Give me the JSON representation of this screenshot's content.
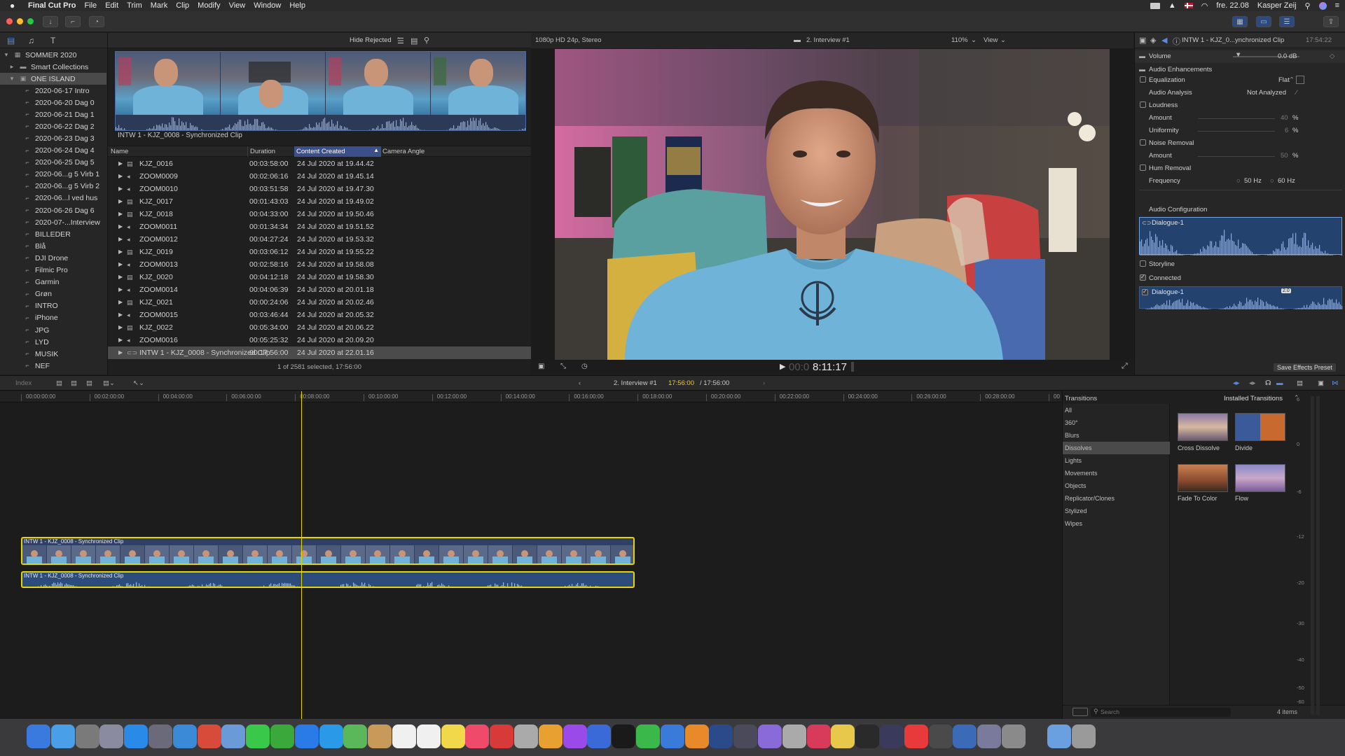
{
  "menubar": {
    "app": "Final Cut Pro",
    "items": [
      "File",
      "Edit",
      "Trim",
      "Mark",
      "Clip",
      "Modify",
      "View",
      "Window",
      "Help"
    ],
    "clock": "fre. 22.08",
    "user": "Kasper Zeij"
  },
  "libraries": {
    "root": "SOMMER 2020",
    "smart": "Smart Collections",
    "island": "ONE ISLAND",
    "items": [
      "2020-06-17 Intro",
      "2020-06-20 Dag 0",
      "2020-06-21 Dag 1",
      "2020-06-22 Dag 2",
      "2020-06-23 Dag 3",
      "2020-06-24 Dag 4",
      "2020-06-25 Dag 5",
      "2020-06...g 5 Virb 1",
      "2020-06...g 5 Virb 2",
      "2020-06...l ved hus",
      "2020-06-26 Dag 6",
      "2020-07-...Interview",
      "BILLEDER",
      "Blå",
      "DJI Drone",
      "Filmic Pro",
      "Garmin",
      "Grøn",
      "INTRO",
      "iPhone",
      "JPG",
      "LYD",
      "MUSIK",
      "NEF"
    ]
  },
  "browser": {
    "hide_rejected": "Hide Rejected",
    "clip_title": "INTW 1 - KJZ_0008 - Synchronized Clip",
    "columns": {
      "name": "Name",
      "duration": "Duration",
      "content_created": "Content Created",
      "camera_angle": "Camera Angle"
    },
    "rows": [
      {
        "name": "KJZ_0016",
        "duration": "00:03:58:00",
        "created": "24 Jul 2020 at 19.44.42",
        "type": "video"
      },
      {
        "name": "ZOOM0009",
        "duration": "00:02:06:16",
        "created": "24 Jul 2020 at 19.45.14",
        "type": "audio"
      },
      {
        "name": "ZOOM0010",
        "duration": "00:03:51:58",
        "created": "24 Jul 2020 at 19.47.30",
        "type": "audio"
      },
      {
        "name": "KJZ_0017",
        "duration": "00:01:43:03",
        "created": "24 Jul 2020 at 19.49.02",
        "type": "video"
      },
      {
        "name": "KJZ_0018",
        "duration": "00:04:33:00",
        "created": "24 Jul 2020 at 19.50.46",
        "type": "video"
      },
      {
        "name": "ZOOM0011",
        "duration": "00:01:34:34",
        "created": "24 Jul 2020 at 19.51.52",
        "type": "audio"
      },
      {
        "name": "ZOOM0012",
        "duration": "00:04:27:24",
        "created": "24 Jul 2020 at 19.53.32",
        "type": "audio"
      },
      {
        "name": "KJZ_0019",
        "duration": "00:03:06:12",
        "created": "24 Jul 2020 at 19.55.22",
        "type": "video"
      },
      {
        "name": "ZOOM0013",
        "duration": "00:02:58:16",
        "created": "24 Jul 2020 at 19.58.08",
        "type": "audio"
      },
      {
        "name": "KJZ_0020",
        "duration": "00:04:12:18",
        "created": "24 Jul 2020 at 19.58.30",
        "type": "video"
      },
      {
        "name": "ZOOM0014",
        "duration": "00:04:06:39",
        "created": "24 Jul 2020 at 20.01.18",
        "type": "audio"
      },
      {
        "name": "KJZ_0021",
        "duration": "00:00:24:06",
        "created": "24 Jul 2020 at 20.02.46",
        "type": "video"
      },
      {
        "name": "ZOOM0015",
        "duration": "00:03:46:44",
        "created": "24 Jul 2020 at 20.05.32",
        "type": "audio"
      },
      {
        "name": "KJZ_0022",
        "duration": "00:05:34:00",
        "created": "24 Jul 2020 at 20.06.22",
        "type": "video"
      },
      {
        "name": "ZOOM0016",
        "duration": "00:05:25:32",
        "created": "24 Jul 2020 at 20.09.20",
        "type": "audio"
      },
      {
        "name": "INTW 1 - KJZ_0008 - Synchronized Clip",
        "duration": "00:17:56:00",
        "created": "24 Jul 2020 at 22.01.16",
        "type": "sync"
      }
    ],
    "status": "1 of 2581 selected, 17:56:00"
  },
  "viewer": {
    "format": "1080p HD 24p, Stereo",
    "title": "2. Interview #1",
    "zoom": "110%",
    "view": "View",
    "timecode_dim": "00:0",
    "timecode": "8:11:17"
  },
  "inspector": {
    "header": "INTW 1 - KJZ_0...ynchronized Clip",
    "header_time": "17:54:22",
    "volume_label": "Volume",
    "volume_value": "0.0 dB",
    "audio_enh": "Audio Enhancements",
    "eq_label": "Equalization",
    "eq_value": "Flat",
    "analysis_label": "Audio Analysis",
    "analysis_value": "Not Analyzed",
    "loudness": "Loudness",
    "amount": "Amount",
    "amount_value": "40",
    "pct": "%",
    "uniformity": "Uniformity",
    "uniformity_value": "6",
    "noise": "Noise Removal",
    "noise_amount_value": "50",
    "hum": "Hum Removal",
    "frequency": "Frequency",
    "freq50": "50 Hz",
    "freq60": "60 Hz",
    "audio_config": "Audio Configuration",
    "dialogue": "Dialogue-1",
    "storyline": "Storyline",
    "connected": "Connected",
    "dialogue2": "Dialogue-1",
    "channel_badge": "2.0",
    "save_preset": "Save Effects Preset"
  },
  "timeline_bar": {
    "index": "Index",
    "project": "2. Interview #1",
    "time": "17:56:00",
    "total": "/ 17:56:00"
  },
  "ruler": [
    "00:00:00:00",
    "00:02:00:00",
    "00:04:00:00",
    "00:06:00:00",
    "00:08:00:00",
    "00:10:00:00",
    "00:12:00:00",
    "00:14:00:00",
    "00:16:00:00",
    "00:18:00:00",
    "00:20:00:00",
    "00:22:00:00",
    "00:24:00:00",
    "00:26:00:00",
    "00:28:00:00",
    "00"
  ],
  "clips": {
    "video_label": "INTW 1 - KJZ_0008 - Synchronized Clip",
    "audio_label": "INTW 1 - KJZ_0008 - Synchronized Clip"
  },
  "transitions": {
    "header": "Transitions",
    "installed": "Installed Transitions",
    "categories": [
      "All",
      "360°",
      "Blurs",
      "Dissolves",
      "Lights",
      "Movements",
      "Objects",
      "Replicator/Clones",
      "Stylized",
      "Wipes"
    ],
    "selected_category": "Dissolves",
    "items": [
      "Cross Dissolve",
      "Divide",
      "Fade To Color",
      "Flow"
    ],
    "search_placeholder": "Search",
    "count": "4 items"
  },
  "meters": [
    "6",
    "0",
    "-6",
    "-12",
    "-20",
    "-30",
    "-40",
    "-50",
    "-60"
  ],
  "colors": {
    "accent": "#3b4f8a",
    "playhead": "#e6d400",
    "clip_border": "#e8d400",
    "role_blue": "#23426e"
  }
}
